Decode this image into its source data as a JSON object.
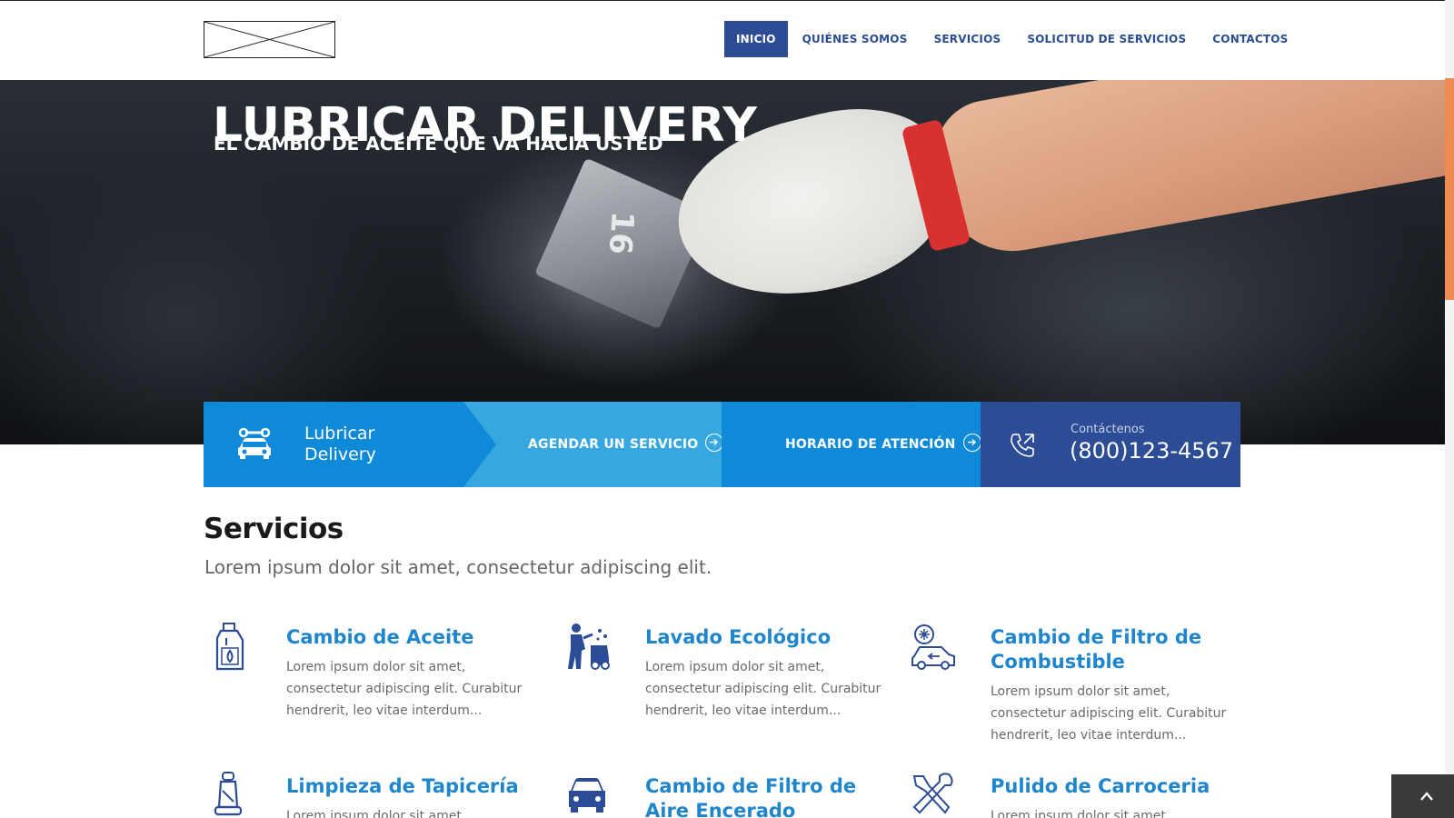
{
  "nav": {
    "items": [
      {
        "label": "INICIO",
        "active": true
      },
      {
        "label": "QUIÉNES SOMOS"
      },
      {
        "label": "SERVICIOS"
      },
      {
        "label": "SOLICITUD DE SERVICIOS"
      },
      {
        "label": "CONTACTOS"
      }
    ]
  },
  "hero": {
    "title": "LUBRICAR DELIVERY",
    "subtitle": "EL CAMBIO DE ACEITE QUE VA HACIA USTED",
    "engine_marking": "16"
  },
  "infobar": {
    "brand_icon": "car-repair-icon",
    "brand_label": "Lubricar Delivery",
    "schedule_label": "AGENDAR UN SERVICIO",
    "hours_label": "HORARIO DE ATENCIÓN",
    "contact_icon": "phone-icon",
    "contact_small": "Contáctenos",
    "contact_phone": "(800)123-4567",
    "colors": {
      "brand": "#0e8ad8",
      "schedule": "#37a8df",
      "hours": "#0e8ad8",
      "contact": "#2c4c96"
    }
  },
  "services": {
    "title": "Servicios",
    "subtitle": "Lorem ipsum dolor sit amet, consectetur adipiscing elit.",
    "items": [
      {
        "icon": "oil-bottle-icon",
        "title": "Cambio de Aceite",
        "text": "Lorem ipsum dolor sit amet, consectetur adipiscing elit. Curabitur hendrerit, leo vitae interdum..."
      },
      {
        "icon": "car-wash-icon",
        "title": "Lavado Ecológico",
        "text": "Lorem ipsum dolor sit amet, consectetur adipiscing elit. Curabitur hendrerit, leo vitae interdum..."
      },
      {
        "icon": "car-filter-icon",
        "title": "Cambio de Filtro de Combustible",
        "text": "Lorem ipsum dolor sit amet, consectetur adipiscing elit. Curabitur hendrerit, leo vitae interdum..."
      },
      {
        "icon": "car-seat-icon",
        "title": "Limpieza de Tapicería",
        "text": "Lorem ipsum dolor sit amet, consectetur"
      },
      {
        "icon": "car-front-icon",
        "title": "Cambio de Filtro de Aire Encerado",
        "text": ""
      },
      {
        "icon": "wrench-screwdriver-icon",
        "title": "Pulido de Carroceria",
        "text": "Lorem ipsum dolor sit amet, consectetur"
      }
    ]
  },
  "accent_color": "#1f86cc"
}
